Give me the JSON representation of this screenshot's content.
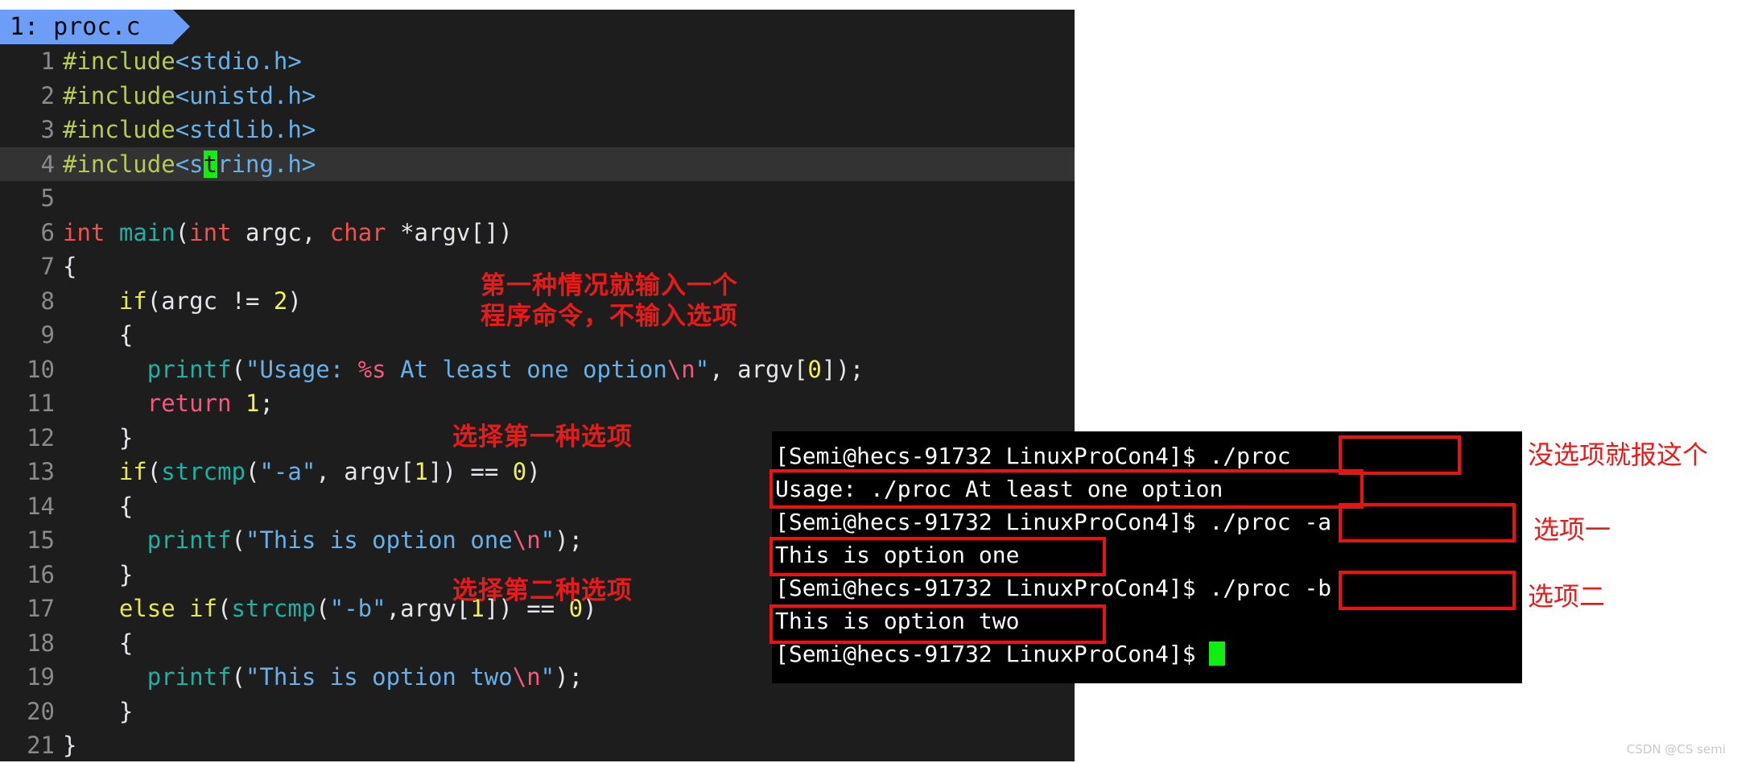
{
  "editor": {
    "tab": {
      "label": "1: proc.c"
    },
    "caret_char": "t",
    "lines": [
      {
        "n": "1",
        "tokens": [
          {
            "t": "#include",
            "c": "t-pre"
          },
          {
            "t": "<stdio.h>",
            "c": "t-hdr"
          }
        ]
      },
      {
        "n": "2",
        "tokens": [
          {
            "t": "#include",
            "c": "t-pre"
          },
          {
            "t": "<unistd.h>",
            "c": "t-hdr"
          }
        ]
      },
      {
        "n": "3",
        "tokens": [
          {
            "t": "#include",
            "c": "t-pre"
          },
          {
            "t": "<stdlib.h>",
            "c": "t-hdr"
          }
        ]
      },
      {
        "n": "4",
        "current": true,
        "tokens": [
          {
            "t": "#include",
            "c": "t-pre"
          },
          {
            "t": "<s",
            "c": "t-hdr"
          },
          {
            "t": "t",
            "c": "t-hdr caret"
          },
          {
            "t": "ring.h>",
            "c": "t-hdr"
          }
        ]
      },
      {
        "n": "5",
        "tokens": [
          {
            "t": "",
            "c": "t-plain"
          }
        ]
      },
      {
        "n": "6",
        "tokens": [
          {
            "t": "int",
            "c": "t-type"
          },
          {
            "t": " ",
            "c": "t-plain"
          },
          {
            "t": "main",
            "c": "t-fn"
          },
          {
            "t": "(",
            "c": "t-punct"
          },
          {
            "t": "int",
            "c": "t-type"
          },
          {
            "t": " argc, ",
            "c": "t-plain"
          },
          {
            "t": "char",
            "c": "t-type"
          },
          {
            "t": " *argv[])",
            "c": "t-plain"
          }
        ]
      },
      {
        "n": "7",
        "tokens": [
          {
            "t": "{",
            "c": "t-plain"
          }
        ]
      },
      {
        "n": "8",
        "tokens": [
          {
            "t": "    ",
            "c": "t-plain"
          },
          {
            "t": "if",
            "c": "t-kw"
          },
          {
            "t": "(argc != ",
            "c": "t-plain"
          },
          {
            "t": "2",
            "c": "t-num"
          },
          {
            "t": ")",
            "c": "t-plain"
          }
        ]
      },
      {
        "n": "9",
        "tokens": [
          {
            "t": "    {",
            "c": "t-plain"
          }
        ]
      },
      {
        "n": "10",
        "tokens": [
          {
            "t": "      ",
            "c": "t-plain"
          },
          {
            "t": "printf",
            "c": "t-fn"
          },
          {
            "t": "(",
            "c": "t-punct"
          },
          {
            "t": "\"Usage: ",
            "c": "t-str"
          },
          {
            "t": "%s",
            "c": "t-esc"
          },
          {
            "t": " At least one option",
            "c": "t-str"
          },
          {
            "t": "\\n",
            "c": "t-esc"
          },
          {
            "t": "\"",
            "c": "t-str"
          },
          {
            "t": ", argv[",
            "c": "t-plain"
          },
          {
            "t": "0",
            "c": "t-num"
          },
          {
            "t": "]);",
            "c": "t-plain"
          }
        ]
      },
      {
        "n": "11",
        "tokens": [
          {
            "t": "      ",
            "c": "t-plain"
          },
          {
            "t": "return",
            "c": "t-ret"
          },
          {
            "t": " ",
            "c": "t-plain"
          },
          {
            "t": "1",
            "c": "t-num"
          },
          {
            "t": ";",
            "c": "t-plain"
          }
        ]
      },
      {
        "n": "12",
        "tokens": [
          {
            "t": "    }",
            "c": "t-plain"
          }
        ]
      },
      {
        "n": "13",
        "tokens": [
          {
            "t": "    ",
            "c": "t-plain"
          },
          {
            "t": "if",
            "c": "t-kw"
          },
          {
            "t": "(",
            "c": "t-punct"
          },
          {
            "t": "strcmp",
            "c": "t-fn"
          },
          {
            "t": "(",
            "c": "t-punct"
          },
          {
            "t": "\"-a\"",
            "c": "t-str"
          },
          {
            "t": ", argv[",
            "c": "t-plain"
          },
          {
            "t": "1",
            "c": "t-num"
          },
          {
            "t": "]) == ",
            "c": "t-plain"
          },
          {
            "t": "0",
            "c": "t-num"
          },
          {
            "t": ")",
            "c": "t-plain"
          }
        ]
      },
      {
        "n": "14",
        "tokens": [
          {
            "t": "    {",
            "c": "t-plain"
          }
        ]
      },
      {
        "n": "15",
        "tokens": [
          {
            "t": "      ",
            "c": "t-plain"
          },
          {
            "t": "printf",
            "c": "t-fn"
          },
          {
            "t": "(",
            "c": "t-punct"
          },
          {
            "t": "\"This is option one",
            "c": "t-str"
          },
          {
            "t": "\\n",
            "c": "t-esc"
          },
          {
            "t": "\"",
            "c": "t-str"
          },
          {
            "t": ");",
            "c": "t-plain"
          }
        ]
      },
      {
        "n": "16",
        "tokens": [
          {
            "t": "    }",
            "c": "t-plain"
          }
        ]
      },
      {
        "n": "17",
        "tokens": [
          {
            "t": "    ",
            "c": "t-plain"
          },
          {
            "t": "else if",
            "c": "t-kw"
          },
          {
            "t": "(",
            "c": "t-punct"
          },
          {
            "t": "strcmp",
            "c": "t-fn"
          },
          {
            "t": "(",
            "c": "t-punct"
          },
          {
            "t": "\"-b\"",
            "c": "t-str"
          },
          {
            "t": ",argv[",
            "c": "t-plain"
          },
          {
            "t": "1",
            "c": "t-num"
          },
          {
            "t": "]) == ",
            "c": "t-plain"
          },
          {
            "t": "0",
            "c": "t-num"
          },
          {
            "t": ")",
            "c": "t-plain"
          }
        ]
      },
      {
        "n": "18",
        "tokens": [
          {
            "t": "    {",
            "c": "t-plain"
          }
        ]
      },
      {
        "n": "19",
        "tokens": [
          {
            "t": "      ",
            "c": "t-plain"
          },
          {
            "t": "printf",
            "c": "t-fn"
          },
          {
            "t": "(",
            "c": "t-punct"
          },
          {
            "t": "\"This is option two",
            "c": "t-str"
          },
          {
            "t": "\\n",
            "c": "t-esc"
          },
          {
            "t": "\"",
            "c": "t-str"
          },
          {
            "t": ");",
            "c": "t-plain"
          }
        ]
      },
      {
        "n": "20",
        "tokens": [
          {
            "t": "    }",
            "c": "t-plain"
          }
        ]
      },
      {
        "n": "21",
        "tokens": [
          {
            "t": "}",
            "c": "t-plain"
          }
        ]
      }
    ]
  },
  "annotations": {
    "code_notes": [
      {
        "id": "cn-a",
        "text": "第一种情况就输入一个\n程序命令，不输入选项"
      },
      {
        "id": "cn-b",
        "text": "选择第一种选项"
      },
      {
        "id": "cn-c",
        "text": "选择第二种选项"
      }
    ],
    "terminal_notes": [
      {
        "id": "cnr-1",
        "text": "没选项就报这个"
      },
      {
        "id": "cnr-2",
        "text": "选项一"
      },
      {
        "id": "cnr-3",
        "text": "选项二"
      }
    ],
    "box_color": "#ee1111"
  },
  "terminal": {
    "prompt": "[Semi@hecs-91732 LinuxProCon4]$ ",
    "lines": [
      {
        "type": "prompt",
        "command": "./proc"
      },
      {
        "type": "output",
        "text": "Usage: ./proc At least one option"
      },
      {
        "type": "prompt",
        "command": "./proc -a"
      },
      {
        "type": "output",
        "text": "This is option one"
      },
      {
        "type": "prompt",
        "command": "./proc -b"
      },
      {
        "type": "output",
        "text": "This is option two"
      },
      {
        "type": "prompt",
        "command": "",
        "cursor": true
      }
    ]
  },
  "watermark": {
    "text": "CSDN @CS semi"
  }
}
